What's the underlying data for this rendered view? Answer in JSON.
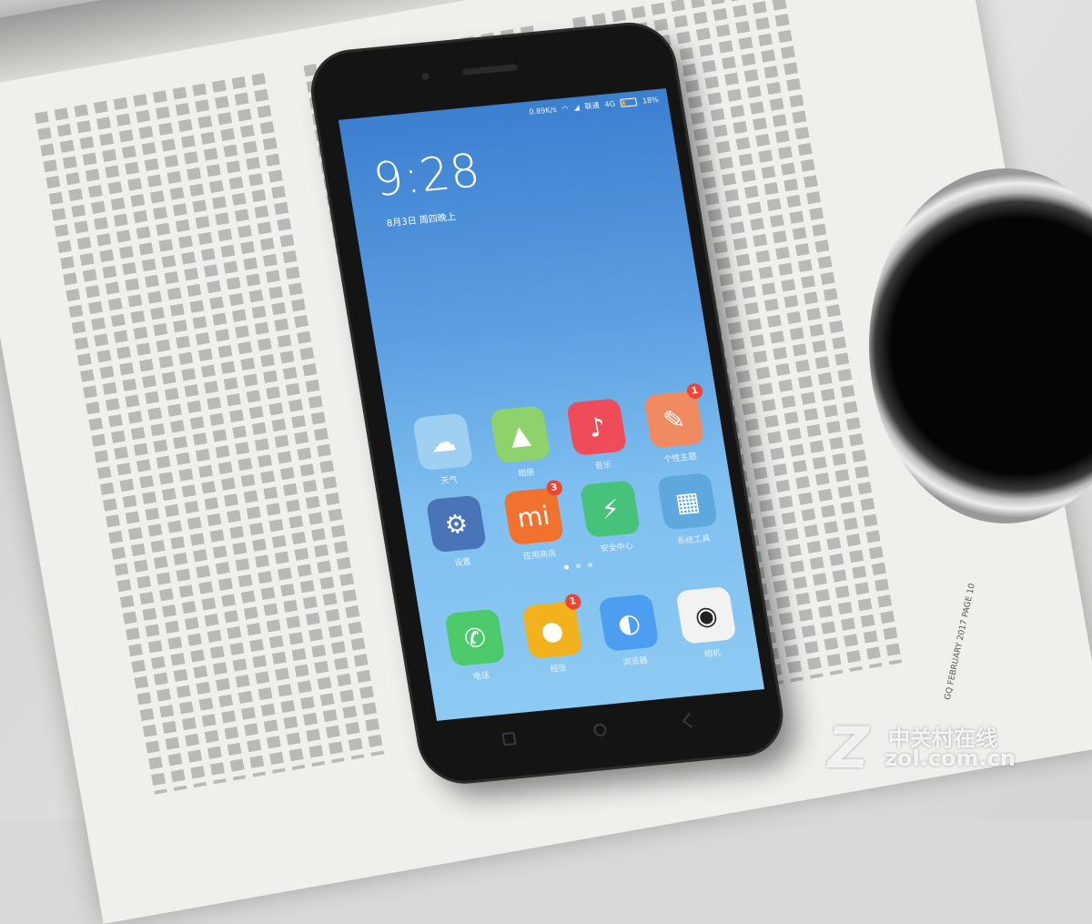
{
  "status_bar": {
    "speed": "0.89K/s",
    "carrier": "联通",
    "network": "4G",
    "battery": "18%"
  },
  "lockscreen": {
    "time": "9:28",
    "date": "8月3日 周四晚上"
  },
  "apps_row1": [
    {
      "label": "天气",
      "icon": "cloud-icon",
      "color": "#9fd0f2",
      "glyph": "☁"
    },
    {
      "label": "相册",
      "icon": "gallery-icon",
      "color": "#8fd16a",
      "glyph": "▲"
    },
    {
      "label": "音乐",
      "icon": "music-icon",
      "color": "#ee4b5b",
      "glyph": "♪"
    },
    {
      "label": "个性主题",
      "icon": "theme-brush-icon",
      "color": "#f08a60",
      "glyph": "✎",
      "badge": "1"
    }
  ],
  "apps_row2": [
    {
      "label": "设置",
      "icon": "gear-icon",
      "color": "#4a74b8",
      "glyph": "⚙"
    },
    {
      "label": "应用商店",
      "icon": "app-store-icon",
      "color": "#f0722e",
      "glyph": "mi",
      "badge": "3"
    },
    {
      "label": "安全中心",
      "icon": "shield-icon",
      "color": "#46c27a",
      "glyph": "⚡"
    },
    {
      "label": "系统工具",
      "icon": "folder-icon",
      "color": "#5fa8de",
      "glyph": "▦"
    }
  ],
  "dock": [
    {
      "label": "电话",
      "icon": "phone-icon",
      "color": "#4cc96a",
      "glyph": "✆"
    },
    {
      "label": "短信",
      "icon": "message-icon",
      "color": "#f2b21d",
      "glyph": "●",
      "badge": "1"
    },
    {
      "label": "浏览器",
      "icon": "browser-icon",
      "color": "#4d9ef0",
      "glyph": "◐"
    },
    {
      "label": "相机",
      "icon": "camera-icon",
      "color": "#f2f2f2",
      "glyph": "◉"
    }
  ],
  "watermark": {
    "logo": "Z",
    "name": "中关村在线",
    "url": "zol.com.cn"
  },
  "magazine_footer": "GQ FEBRUARY 2017 PAGE 10"
}
